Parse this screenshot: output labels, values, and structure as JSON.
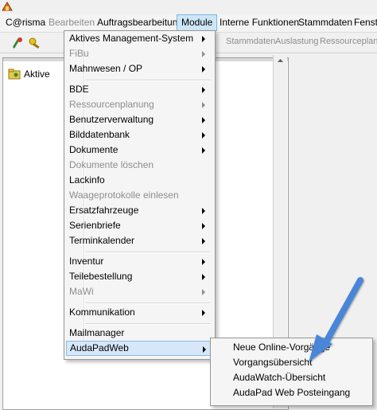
{
  "menubar": {
    "items": [
      {
        "label": "C@risma",
        "state": "normal"
      },
      {
        "label": "Bearbeiten",
        "state": "disabled"
      },
      {
        "label": "Auftragsbearbeitung",
        "state": "normal"
      },
      {
        "label": "Module",
        "state": "active"
      },
      {
        "label": "Interne Funktionen",
        "state": "normal"
      },
      {
        "label": "Stammdaten",
        "state": "normal"
      },
      {
        "label": "Fenste",
        "state": "normal"
      }
    ]
  },
  "toolbar": {
    "texts": [
      "Stammdaten",
      "Auslastung",
      "Ressourceplane"
    ]
  },
  "tree": {
    "items": [
      {
        "label": "Aktive"
      }
    ]
  },
  "module_menu": {
    "items": [
      {
        "label": "Aktives Management-System",
        "disabled": false,
        "submenu": true
      },
      {
        "label": "FiBu",
        "disabled": true,
        "submenu": true
      },
      {
        "label": "Mahnwesen / OP",
        "disabled": false,
        "submenu": true
      },
      {
        "label": "BDE",
        "disabled": false,
        "submenu": true
      },
      {
        "label": "Ressourcenplanung",
        "disabled": true,
        "submenu": true
      },
      {
        "label": "Benutzerverwaltung",
        "disabled": false,
        "submenu": true
      },
      {
        "label": "Bilddatenbank",
        "disabled": false,
        "submenu": true
      },
      {
        "label": "Dokumente",
        "disabled": false,
        "submenu": true
      },
      {
        "label": "Dokumente löschen",
        "disabled": true,
        "submenu": false
      },
      {
        "label": "Lackinfo",
        "disabled": false,
        "submenu": false
      },
      {
        "label": "Waageprotokolle einlesen",
        "disabled": true,
        "submenu": false
      },
      {
        "label": "Ersatzfahrzeuge",
        "disabled": false,
        "submenu": true
      },
      {
        "label": "Serienbriefe",
        "disabled": false,
        "submenu": true
      },
      {
        "label": "Terminkalender",
        "disabled": false,
        "submenu": true
      },
      {
        "label": "Inventur",
        "disabled": false,
        "submenu": true
      },
      {
        "label": "Teilebestellung",
        "disabled": false,
        "submenu": true
      },
      {
        "label": "MaWi",
        "disabled": true,
        "submenu": true
      },
      {
        "label": "Kommunikation",
        "disabled": false,
        "submenu": true
      },
      {
        "label": "Mailmanager",
        "disabled": false,
        "submenu": false
      },
      {
        "label": "AudaPadWeb",
        "disabled": false,
        "submenu": true,
        "highlighted": true
      }
    ]
  },
  "audapad_submenu": {
    "items": [
      {
        "label": "Neue Online-Vorgänge"
      },
      {
        "label": "Vorgangsübersicht"
      },
      {
        "label": "AudaWatch-Übersicht"
      },
      {
        "label": "AudaPad Web Posteingang"
      }
    ]
  },
  "annotation": {
    "arrow_color": "#4a86d8"
  }
}
